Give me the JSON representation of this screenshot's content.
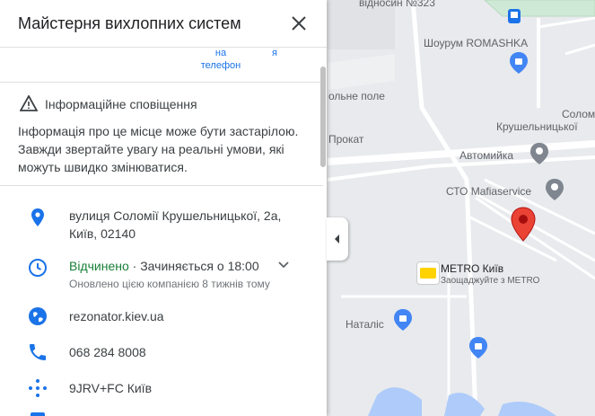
{
  "header": {
    "title": "Майстерня вихлопних систем"
  },
  "actions": {
    "label_left": "на\nтелефон",
    "label_right": "я"
  },
  "notice": {
    "title": "Інформаційне сповіщення",
    "text": "Інформація про це місце може бути застарілою. Завжди звертайте увагу на реальні умови, які можуть швидко змінюватися."
  },
  "details": {
    "address": "вулиця Соломії Крушельницької, 2а, Київ, 02140",
    "status_open": "Відчинено",
    "status_rest": " · Зачиняється о 18:00",
    "updated": "Оновлено цією компанією 8 тижнів тому",
    "website": "rezonator.kiev.ua",
    "phone": "068 284 8008",
    "plus_code": "9JRV+FC Київ"
  },
  "map": {
    "labels": {
      "top": "відносин №323",
      "showroom": "Шоурум ROMASHKA",
      "field": "ольне поле",
      "kruschel": "Крушельницької",
      "solom": "Солом",
      "prokat": "Прокат",
      "carwash": "Автомийка",
      "sto": "СТО Mafiaservice",
      "metro_title": "METRO Київ",
      "metro_sub": "Заощаджуйте з METRO",
      "natalis": "Наталіс"
    }
  },
  "colors": {
    "accent": "#1a73e8",
    "open": "#188038",
    "pin": "#ea4335"
  }
}
